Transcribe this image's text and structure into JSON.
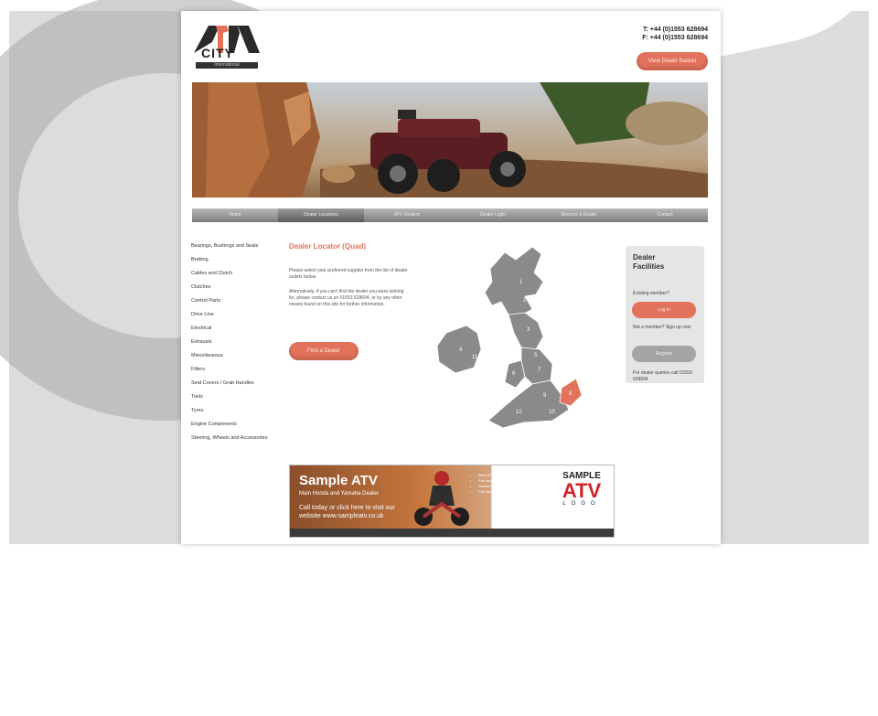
{
  "header": {
    "logo_text": "CITY",
    "logo_sub": "International",
    "phone": "T: +44 (0)1553 628694",
    "fax": "F: +44 (0)1553 628694",
    "top_button": "View Dealer Basket"
  },
  "nav": {
    "items": [
      "Home",
      "Dealer Locations",
      "ATV Dealers",
      "Dealer Login",
      "Become a Dealer",
      "Contact"
    ]
  },
  "sidebar": {
    "categories": [
      "Bearings, Bushings and Seals",
      "Braking",
      "Cables and Clutch",
      "Clutches",
      "Control Parts",
      "Drive Line",
      "Electrical",
      "Exhausts",
      "Miscellaneous",
      "Filters",
      "Seat Covers / Grab Handles",
      "Tools",
      "Tyres",
      "Engine Components",
      "Steering, Wheels and Accessories"
    ]
  },
  "dealer": {
    "title": "Dealer Locator (Quad)",
    "para1": "Please select your preferred supplier from the list of dealer outlets below.",
    "para2": "Alternatively, if you can't find the dealer you were looking for, please contact us on 01553 628694, or by any other means found on this site for further information.",
    "button": "Find a Dealer"
  },
  "panel": {
    "title": "Dealer Facilities",
    "existing": "Existing member?",
    "login_btn": "Log In",
    "new_member": "Not a member? Sign up now",
    "register_btn": "Register",
    "footer": "For dealer queries call 01553 628694"
  },
  "banner": {
    "title": "Sample ATV",
    "subtitle": "Main Honda and Yamaha Dealer",
    "call": "Call today or click here to visit our website www.sampleatv.co.uk",
    "bullets": [
      "Rent ATVs from our range",
      "Full range of new and used ATVs",
      "Service to all makes of ATV",
      "Full range of parts and accessories"
    ],
    "brand_top": "SAMPLE",
    "brand_main": "ATV",
    "brand_bottom": "LOGO"
  },
  "map_regions": [
    "1",
    "2",
    "3",
    "4",
    "5",
    "6",
    "7",
    "8",
    "9",
    "10",
    "11",
    "12"
  ],
  "colors": {
    "accent": "#e2725b",
    "nav_grey": "#8c8c8c",
    "map_grey": "#8a8a8a",
    "map_highlight": "#e2725b"
  }
}
